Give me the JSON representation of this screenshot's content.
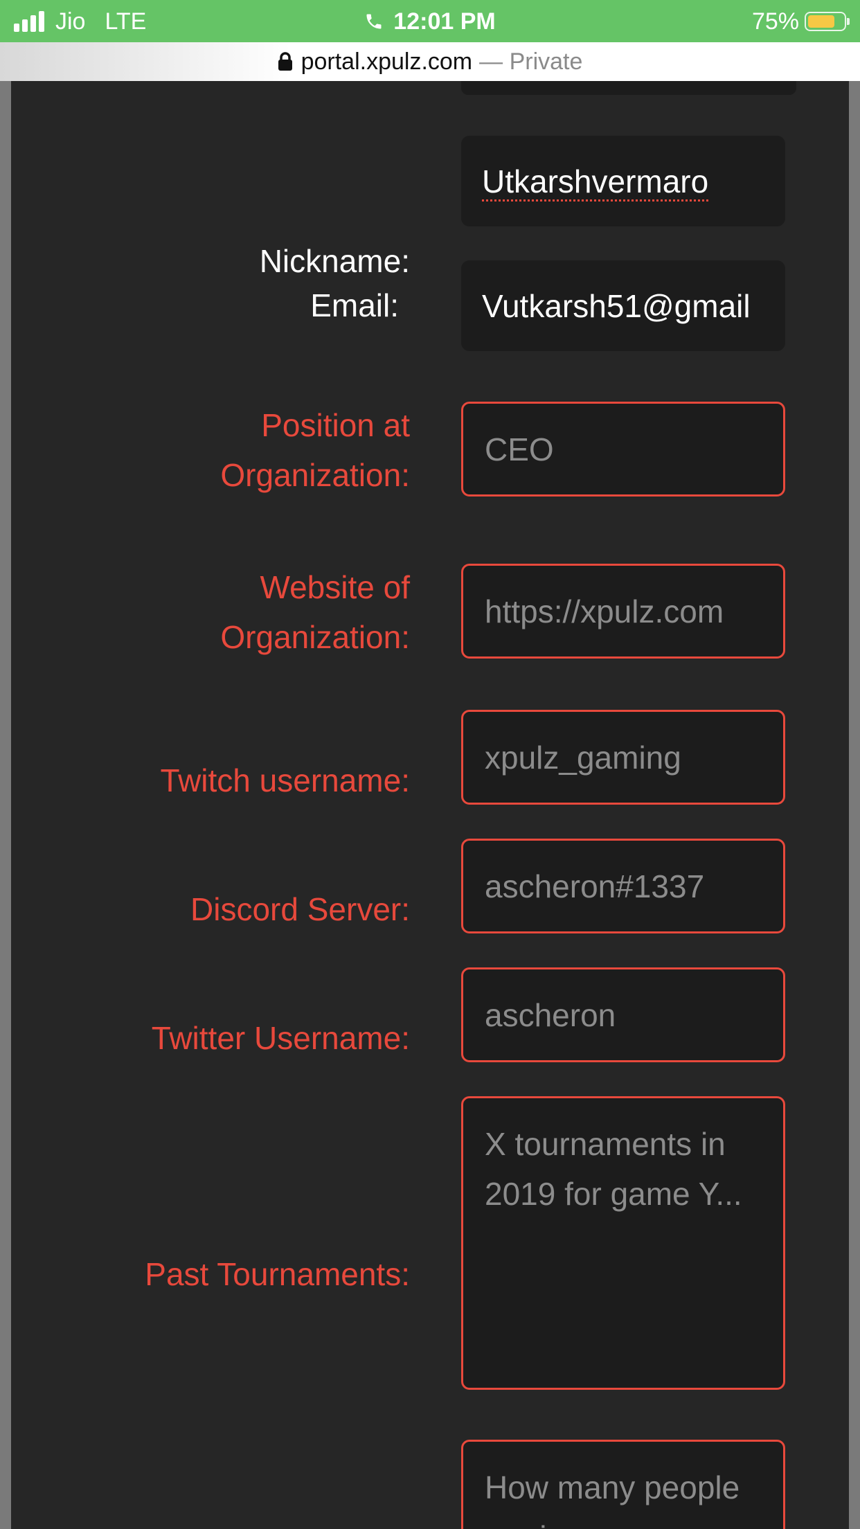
{
  "status_bar": {
    "carrier": "Jio",
    "network": "LTE",
    "time": "12:01 PM",
    "battery_percent": "75%",
    "battery_level": 0.75,
    "icons": [
      "signal-icon",
      "phone-icon",
      "battery-icon"
    ]
  },
  "browser": {
    "url": "portal.xpulz.com",
    "separator": "—",
    "mode": "Private",
    "icon": "lock-icon"
  },
  "form": {
    "nickname": {
      "label": "Nickname:",
      "value": "Utkarshvermaro"
    },
    "email": {
      "label": "Email:",
      "value": "Vutkarsh51@gmail"
    },
    "position": {
      "label_line1": "Position at",
      "label_line2": "Organization:",
      "placeholder": "CEO"
    },
    "website": {
      "label_line1": "Website of",
      "label_line2": "Organization:",
      "placeholder": "https://xpulz.com"
    },
    "twitch": {
      "label": "Twitch username:",
      "placeholder": "xpulz_gaming"
    },
    "discord": {
      "label": "Discord Server:",
      "placeholder": "ascheron#1337"
    },
    "twitter": {
      "label": "Twitter Username:",
      "placeholder": "ascheron"
    },
    "tournaments": {
      "label": "Past Tournaments:",
      "placeholder": "X tournaments in 2019 for game Y..."
    },
    "people": {
      "placeholder": "How many people are in your"
    }
  },
  "colors": {
    "status_bar": "#65c466",
    "page_background": "#262626",
    "field_background": "#1c1c1c",
    "required_accent": "#e8493c",
    "placeholder_text": "#8c8c8c",
    "battery_fill": "#f7c845"
  }
}
